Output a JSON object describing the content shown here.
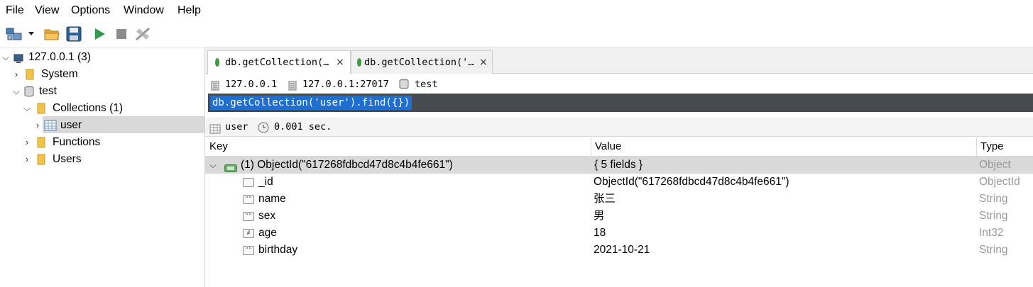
{
  "menu": [
    "File",
    "View",
    "Options",
    "Window",
    "Help"
  ],
  "toolbar": {
    "icons": [
      "connect-icon",
      "dropdown-arrow-icon",
      "open-folder-icon",
      "save-icon",
      "run-icon",
      "stop-icon",
      "disconnect-icon"
    ]
  },
  "tree": {
    "server": "127.0.0.1 (3)",
    "system": "System",
    "db": "test",
    "collections": "Collections (1)",
    "collection_user": "user",
    "functions": "Functions",
    "users": "Users"
  },
  "tabs": [
    {
      "label": "db.getCollection(…",
      "active": true
    },
    {
      "label": "db.getCollection('…",
      "active": false
    }
  ],
  "connection": {
    "host": "127.0.0.1",
    "server": "127.0.0.1:27017",
    "database": "test"
  },
  "query": "db.getCollection('user').find({})",
  "results_bar": {
    "collection": "user",
    "time": "0.001 sec."
  },
  "grid": {
    "headers": {
      "key": "Key",
      "value": "Value",
      "type": "Type"
    },
    "doc": {
      "key": "(1) ObjectId(\"617268fdbcd47d8c4b4fe661\")",
      "value": "{ 5 fields }",
      "type": "Object"
    },
    "fields": [
      {
        "icon": "id-icon",
        "key": "_id",
        "value": "ObjectId(\"617268fdbcd47d8c4b4fe661\")",
        "type": "ObjectId"
      },
      {
        "icon": "string-icon",
        "key": "name",
        "value": "张三",
        "type": "String"
      },
      {
        "icon": "string-icon",
        "key": "sex",
        "value": "男",
        "type": "String"
      },
      {
        "icon": "number-icon",
        "key": "age",
        "value": "18",
        "type": "Int32"
      },
      {
        "icon": "string-icon",
        "key": "birthday",
        "value": "2021-10-21",
        "type": "String"
      }
    ]
  }
}
